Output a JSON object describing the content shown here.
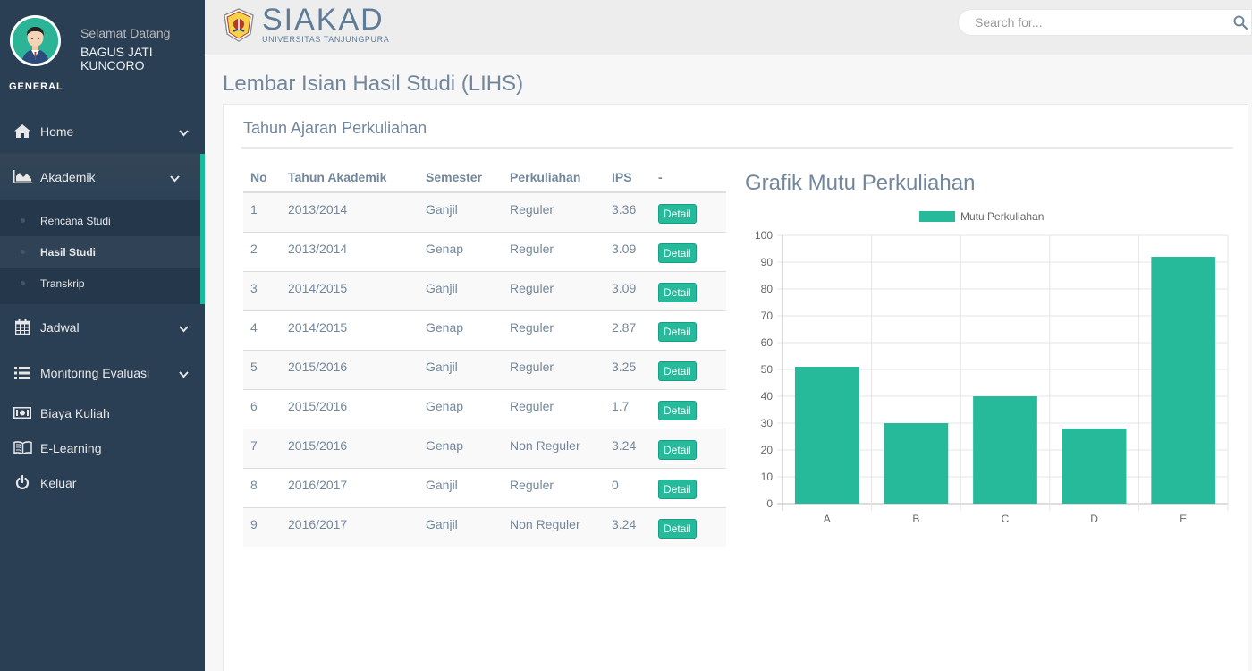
{
  "sidebar": {
    "welcome": "Selamat Datang",
    "username": "BAGUS JATI KUNCORO",
    "section": "GENERAL",
    "menu": {
      "home": "Home",
      "akademik": "Akademik",
      "rencana_studi": "Rencana Studi",
      "hasil_studi": "Hasil Studi",
      "transkrip": "Transkrip",
      "jadwal": "Jadwal",
      "monitoring": "Monitoring Evaluasi",
      "biaya": "Biaya Kuliah",
      "elearning": "E-Learning",
      "keluar": "Keluar"
    }
  },
  "topnav": {
    "logo_title": "SIAKAD",
    "logo_sub": "UNIVERSITAS TANJUNGPURA",
    "search_placeholder": "Search for..."
  },
  "page_title": "Lembar Isian Hasil Studi (LIHS)",
  "panel_title": "Tahun Ajaran Perkuliahan",
  "table": {
    "headers": [
      "No",
      "Tahun Akademik",
      "Semester",
      "Perkuliahan",
      "IPS",
      "-"
    ],
    "button_label": "Detail",
    "rows": [
      [
        "1",
        "2013/2014",
        "Ganjil",
        "Reguler",
        "3.36"
      ],
      [
        "2",
        "2013/2014",
        "Genap",
        "Reguler",
        "3.09"
      ],
      [
        "3",
        "2014/2015",
        "Ganjil",
        "Reguler",
        "3.09"
      ],
      [
        "4",
        "2014/2015",
        "Genap",
        "Reguler",
        "2.87"
      ],
      [
        "5",
        "2015/2016",
        "Ganjil",
        "Reguler",
        "3.25"
      ],
      [
        "6",
        "2015/2016",
        "Genap",
        "Reguler",
        "1.7"
      ],
      [
        "7",
        "2015/2016",
        "Genap",
        "Non Reguler",
        "3.24"
      ],
      [
        "8",
        "2016/2017",
        "Ganjil",
        "Reguler",
        "0"
      ],
      [
        "9",
        "2016/2017",
        "Ganjil",
        "Non Reguler",
        "3.24"
      ]
    ]
  },
  "chart_heading": "Grafik Mutu Perkuliahan",
  "chart_data": {
    "type": "bar",
    "categories": [
      "A",
      "B",
      "C",
      "D",
      "E"
    ],
    "series": [
      {
        "name": "Mutu Perkuliahan",
        "values": [
          51,
          30,
          40,
          28,
          92
        ]
      }
    ],
    "ylim": [
      0,
      100
    ],
    "yticks": [
      0,
      10,
      20,
      30,
      40,
      50,
      60,
      70,
      80,
      90,
      100
    ],
    "legend": "top",
    "grid": true,
    "color": "#26b99a"
  },
  "colors": {
    "accent": "#1abb9c",
    "sidebar": "#2a3f54",
    "button": "#26b99a"
  }
}
